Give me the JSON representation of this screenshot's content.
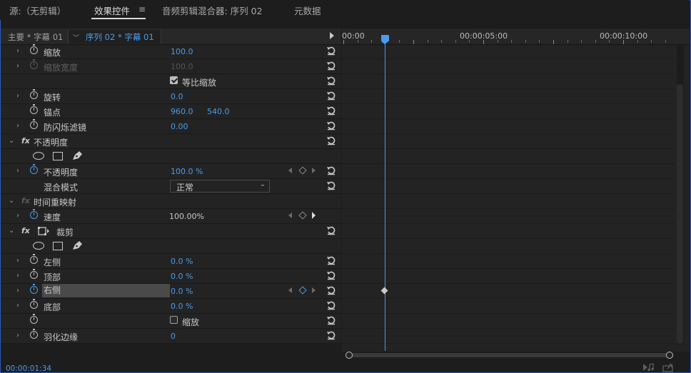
{
  "tabs": [
    {
      "label": "源:（无剪辑）",
      "active": false
    },
    {
      "label": "效果控件",
      "active": true,
      "menu_icon": "hamburger-icon"
    },
    {
      "label": "音频剪辑混合器: 序列 02",
      "active": false
    },
    {
      "label": "元数据",
      "active": false
    }
  ],
  "header": {
    "master_clip": "主要 * 字幕 01",
    "sequence_clip": "序列 02 * 字幕 01"
  },
  "timeline": {
    "ruler": [
      "00:00",
      "00:00:05:00",
      "00:00:10:00"
    ]
  },
  "properties": [
    {
      "label": "缩放",
      "value": "100.0"
    },
    {
      "label": "缩放宽度",
      "value": "100.0",
      "disabled": true
    },
    {
      "checkbox_label": "等比缩放",
      "checked": true
    },
    {
      "label": "旋转",
      "value": "0.0"
    },
    {
      "label": "锚点",
      "value_x": "960.0",
      "value_y": "540.0"
    },
    {
      "label": "防闪烁滤镜",
      "value": "0.00"
    },
    {
      "section": "不透明度"
    },
    {
      "label": "不透明度",
      "value": "100.0 %"
    },
    {
      "label": "混合模式",
      "select": "正常"
    },
    {
      "section": "时间重映射"
    },
    {
      "label": "速度",
      "value": "100.00%"
    },
    {
      "section": "裁剪"
    },
    {
      "label": "左侧",
      "value": "0.0 %"
    },
    {
      "label": "顶部",
      "value": "0.0 %"
    },
    {
      "label": "右侧",
      "value": "0.0 %",
      "selected": true
    },
    {
      "label": "底部",
      "value": "0.0 %"
    },
    {
      "checkbox_label": "缩放",
      "checked": false
    },
    {
      "label": "羽化边缘",
      "value": "0"
    }
  ],
  "status": {
    "timecode": "00:00:01:34"
  },
  "colors": {
    "accent": "#4b9ce8",
    "panel": "#232323",
    "background": "#1d1d1d"
  }
}
